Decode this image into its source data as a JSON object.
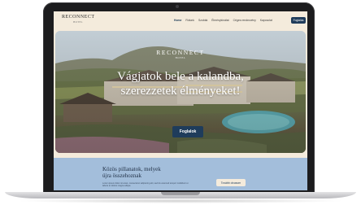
{
  "header": {
    "logo_main": "RECONNECT",
    "logo_sub": "HOTEL",
    "nav": [
      "Home",
      "Rólunk",
      "Szobák",
      "Élménykínálat",
      "Céges rendezvény",
      "Kapcsolat"
    ],
    "book_label": "Foglalás"
  },
  "hero": {
    "brand": "RECONNECT",
    "brand_sub": "HOTEL",
    "title_line1": "Vágjatok bele a kalandba,",
    "title_line2": "szerezzetek élményeket!",
    "button_label": "Foglalok"
  },
  "section": {
    "title_line1": "Közös pillanatok, melyek",
    "title_line2": "újra összehoznak",
    "text": "Lorem ipsum dolor sit amet, consectetur adipiscing elit, sed do eiusmod tempor incididunt ut labore et dolore magna aliqua.",
    "button_label": "Tovább olvasom"
  },
  "colors": {
    "accent": "#1f3c5b",
    "header_bg": "#f4ebdc",
    "section_bg": "#a3bedb"
  }
}
